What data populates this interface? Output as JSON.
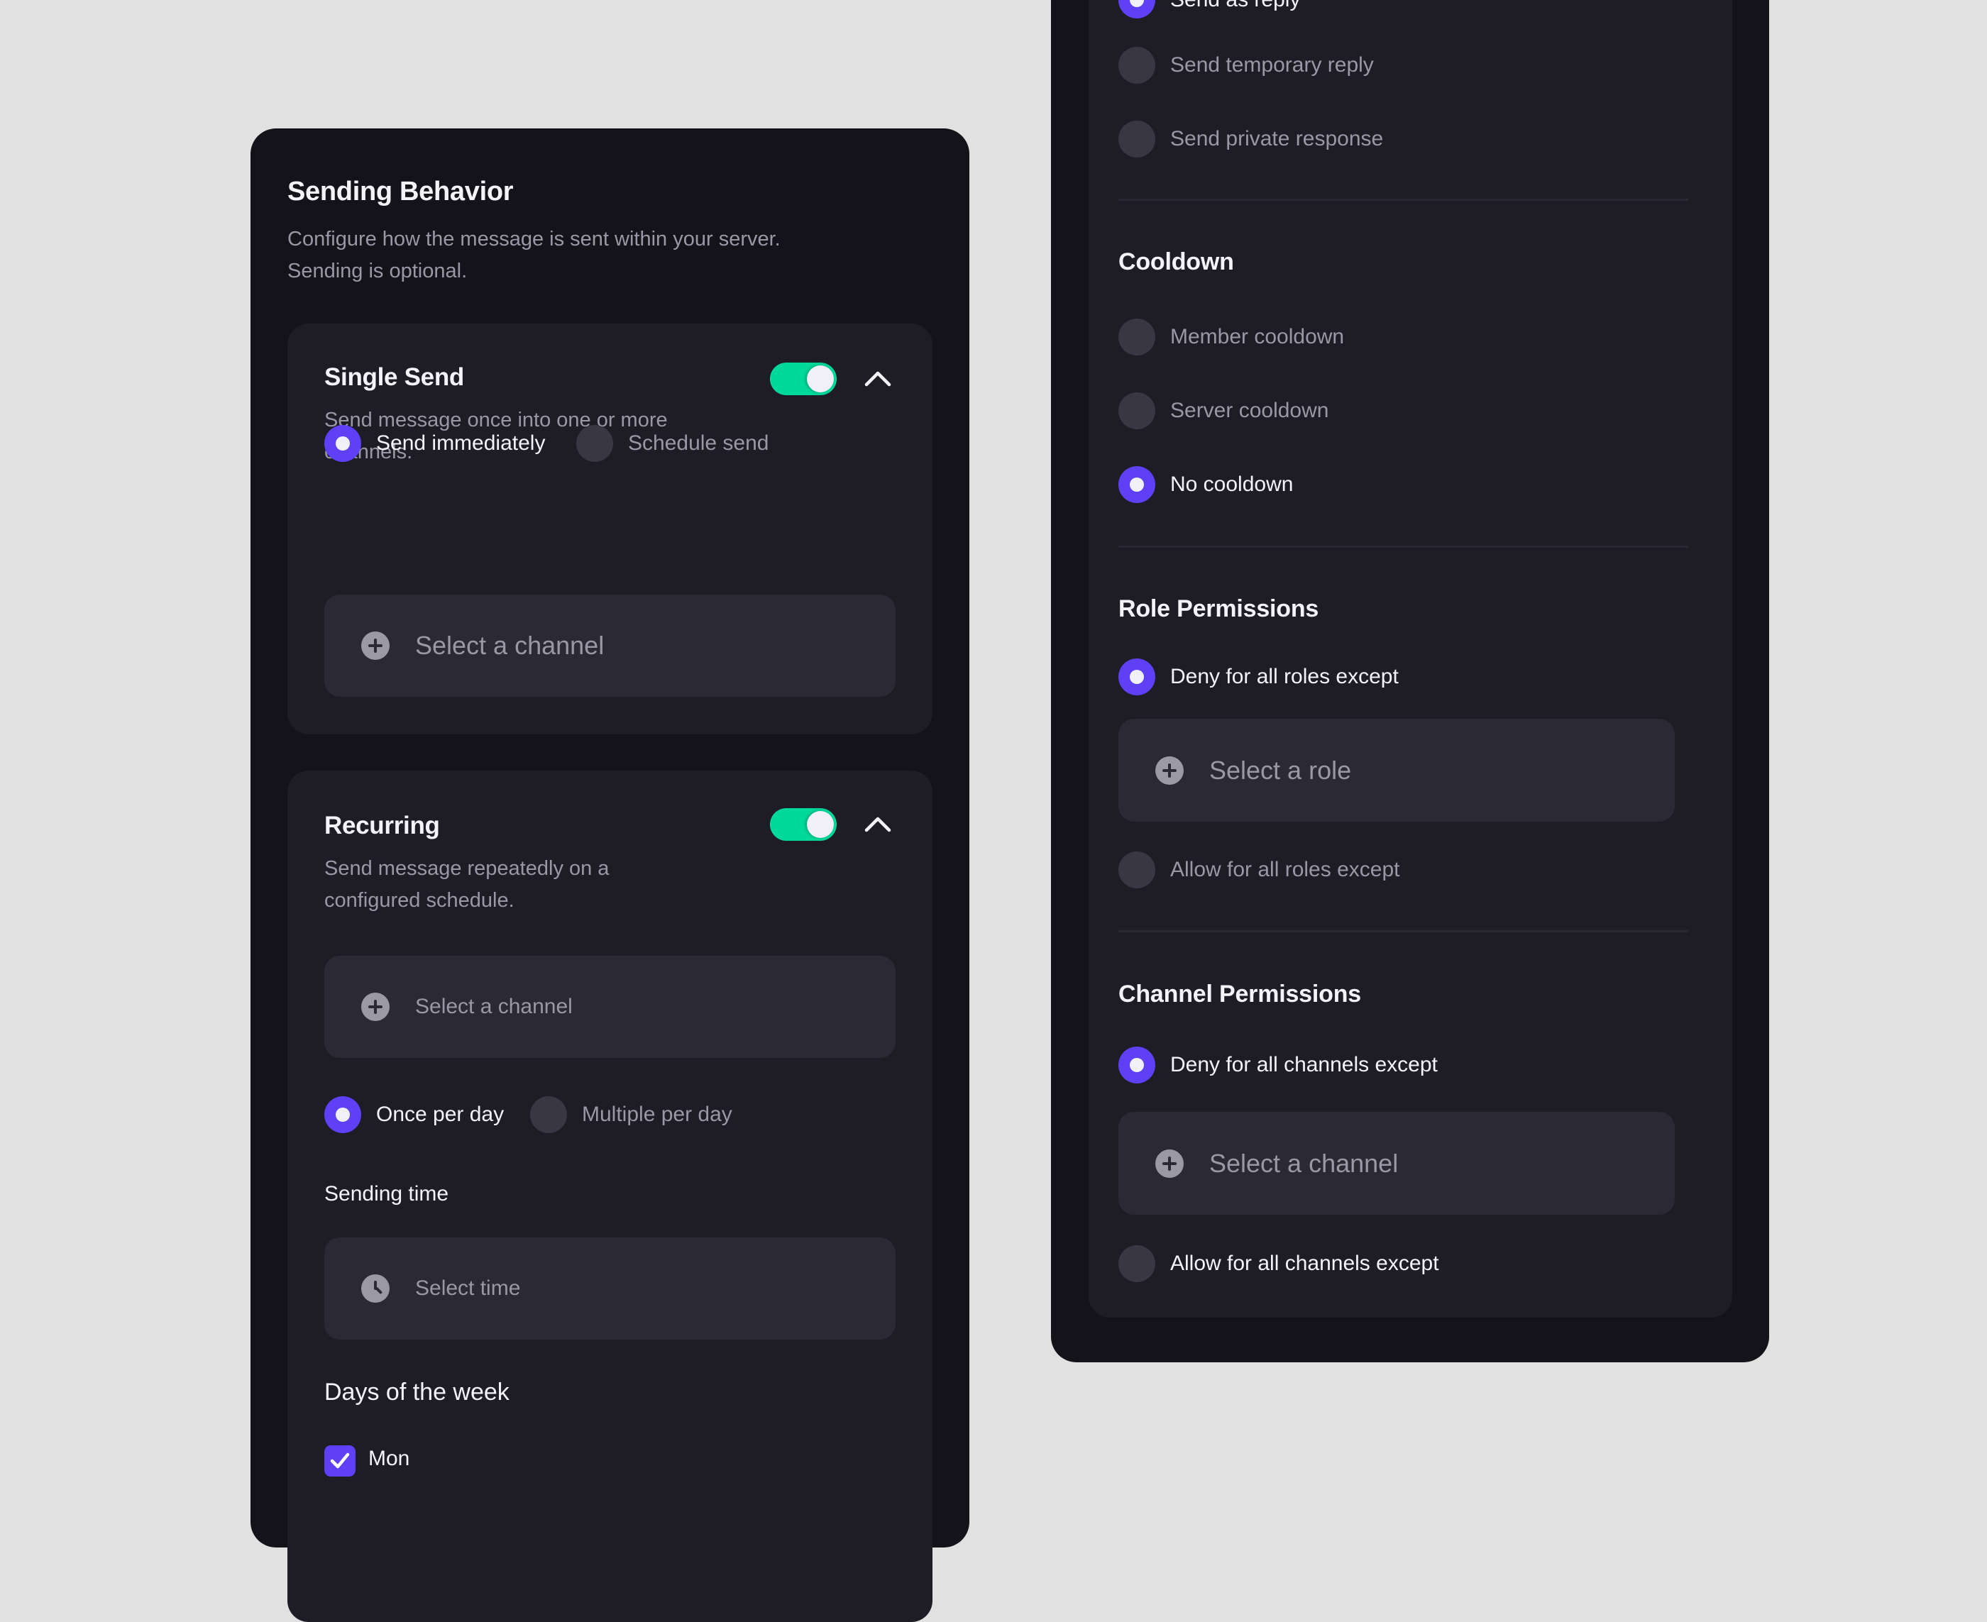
{
  "colors": {
    "background": "#e1e1e1",
    "panel": "#131319",
    "card": "#1e1d26",
    "input": "#2a2934",
    "accent": "#5f40f6",
    "toggle_on": "#00d99a",
    "text_primary": "#f4f4f8",
    "text_secondary": "#9a98a6"
  },
  "left_panel": {
    "title": "Sending Behavior",
    "description_line1": "Configure how the message is sent within your server.",
    "description_line2": "Sending is optional.",
    "single_send": {
      "title": "Single Send",
      "enabled": true,
      "expanded": true,
      "description_line1": "Send message once into one or more",
      "description_line2": "channels.",
      "options": [
        {
          "label": "Send immediately",
          "selected": true
        },
        {
          "label": "Schedule send",
          "selected": false
        }
      ],
      "channel_placeholder": "Select a channel",
      "channel_icon": "plus-circle-icon"
    },
    "recurring": {
      "title": "Recurring",
      "enabled": true,
      "expanded": true,
      "description_line1": "Send message repeatedly on a",
      "description_line2": "configured schedule.",
      "channel_placeholder": "Select a channel",
      "channel_icon": "plus-circle-icon",
      "frequency_options": [
        {
          "label": "Once per day",
          "selected": true
        },
        {
          "label": "Multiple per day",
          "selected": false
        }
      ],
      "sending_time_label": "Sending time",
      "time_placeholder": "Select time",
      "time_icon": "clock-icon",
      "days_label": "Days of the week",
      "days": [
        {
          "label": "Mon",
          "checked": true
        }
      ]
    }
  },
  "right_panel": {
    "reply_options": [
      {
        "label": "Send as reply",
        "selected": true
      },
      {
        "label": "Send temporary reply",
        "selected": false
      },
      {
        "label": "Send private response",
        "selected": false
      }
    ],
    "cooldown": {
      "title": "Cooldown",
      "options": [
        {
          "label": "Member cooldown",
          "selected": false
        },
        {
          "label": "Server cooldown",
          "selected": false
        },
        {
          "label": "No cooldown",
          "selected": true
        }
      ]
    },
    "role_permissions": {
      "title": "Role Permissions",
      "options": [
        {
          "label": "Deny for all roles except",
          "selected": true
        },
        {
          "label": "Allow for all roles except",
          "selected": false
        }
      ],
      "role_placeholder": "Select a role"
    },
    "channel_permissions": {
      "title": "Channel Permissions",
      "options": [
        {
          "label": "Deny for all channels except",
          "selected": true
        },
        {
          "label": "Allow for all channels except",
          "selected": false
        }
      ],
      "channel_placeholder": "Select a channel"
    }
  }
}
